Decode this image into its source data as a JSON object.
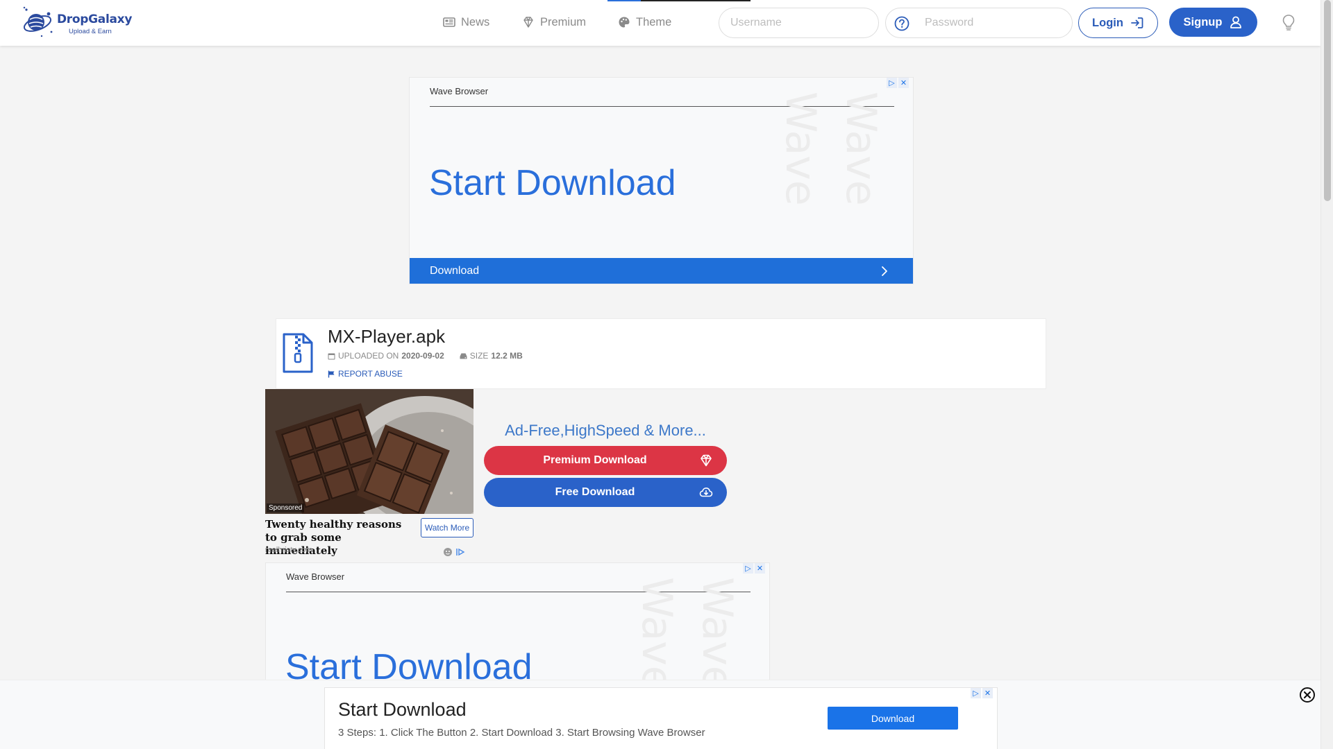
{
  "brand": {
    "name": "DropGalaxy",
    "tagline": "Upload & Earn"
  },
  "nav": {
    "links": [
      {
        "label": "News",
        "icon": "newspaper-icon"
      },
      {
        "label": "Premium",
        "icon": "diamond-icon"
      },
      {
        "label": "Theme",
        "icon": "palette-icon"
      }
    ],
    "username_placeholder": "Username",
    "password_placeholder": "Password",
    "login_label": "Login",
    "signup_label": "Signup"
  },
  "top_ad": {
    "brand": "Wave Browser",
    "headline": "Start Download",
    "watermark": "Wave",
    "cta": "Download"
  },
  "file": {
    "name": "MX-Player.apk",
    "uploaded_label": "UPLOADED ON",
    "uploaded_date": "2020-09-02",
    "size_label": "SIZE",
    "size_value": "12.2 MB",
    "report_label": "REPORT ABUSE"
  },
  "sponsored": {
    "tag": "Sponsored",
    "title": "Twenty healthy reasons to grab some immediately",
    "source": "realhristy.com",
    "button": "Watch More"
  },
  "download": {
    "promo": "Ad-Free,HighSpeed & More...",
    "premium_label": "Premium Download",
    "free_label": "Free Download"
  },
  "mid_ad": {
    "brand": "Wave Browser",
    "headline": "Start Download",
    "watermark": "Wave"
  },
  "sticky_ad": {
    "title": "Start Download",
    "subtitle": "3 Steps: 1. Click The Button 2. Start Download 3. Start Browsing Wave Browser",
    "button": "Download"
  },
  "colors": {
    "accent_blue": "#2a62c9",
    "premium_red": "#dc3545",
    "ad_blue": "#1f6fd9"
  }
}
